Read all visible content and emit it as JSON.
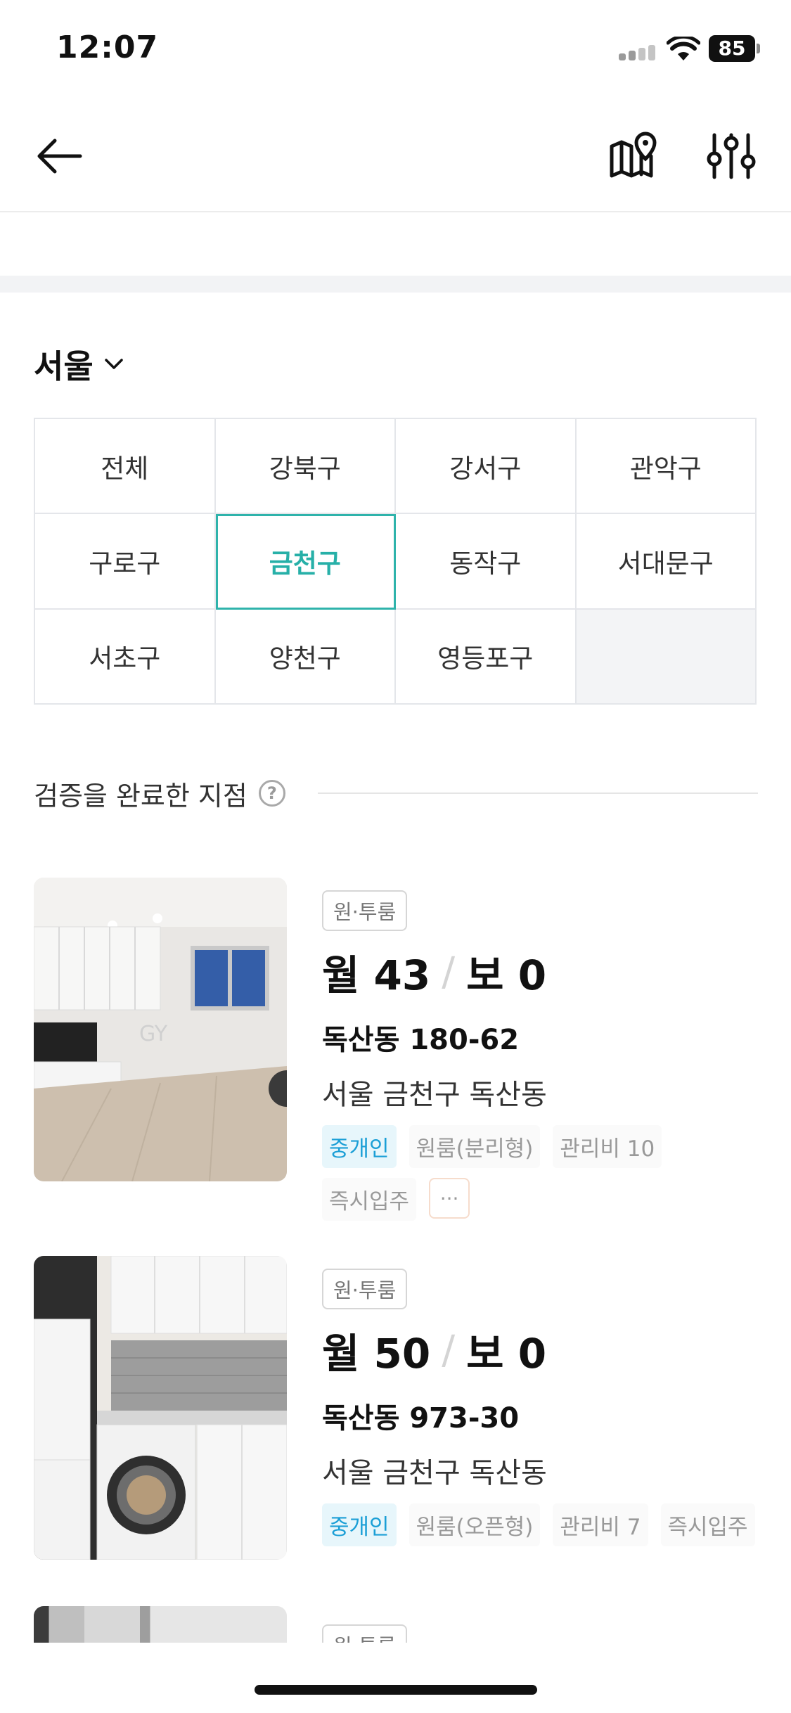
{
  "status_bar": {
    "time": "12:07",
    "battery": "85"
  },
  "region": {
    "name": "서울"
  },
  "districts": [
    {
      "label": "전체",
      "selected": false
    },
    {
      "label": "강북구",
      "selected": false
    },
    {
      "label": "강서구",
      "selected": false
    },
    {
      "label": "관악구",
      "selected": false
    },
    {
      "label": "구로구",
      "selected": false
    },
    {
      "label": "금천구",
      "selected": true
    },
    {
      "label": "동작구",
      "selected": false
    },
    {
      "label": "서대문구",
      "selected": false
    },
    {
      "label": "서초구",
      "selected": false
    },
    {
      "label": "양천구",
      "selected": false
    },
    {
      "label": "영등포구",
      "selected": false
    }
  ],
  "section": {
    "title": "검증을 완료한 지점",
    "help_symbol": "?"
  },
  "listings": [
    {
      "type": "원·투룸",
      "rent": "월 43",
      "separator": "/",
      "deposit": "보 0",
      "address": "독산동 180-62",
      "location": "서울 금천구 독산동",
      "tags": [
        "중개인",
        "원룸(분리형)",
        "관리비 10",
        "즉시입주"
      ],
      "more": "···"
    },
    {
      "type": "원·투룸",
      "rent": "월 50",
      "separator": "/",
      "deposit": "보 0",
      "address": "독산동 973-30",
      "location": "서울 금천구 독산동",
      "tags": [
        "중개인",
        "원룸(오픈형)",
        "관리비 7",
        "즉시입주"
      ]
    }
  ],
  "partial_listing": {
    "type": "원·투룸"
  },
  "colors": {
    "accent": "#27b0a8",
    "broker_tag": "#1b9fd6",
    "text": "#111111"
  },
  "icons": [
    "back-arrow-icon",
    "map-pin-icon",
    "filter-sliders-icon",
    "chevron-down-icon",
    "help-icon"
  ]
}
